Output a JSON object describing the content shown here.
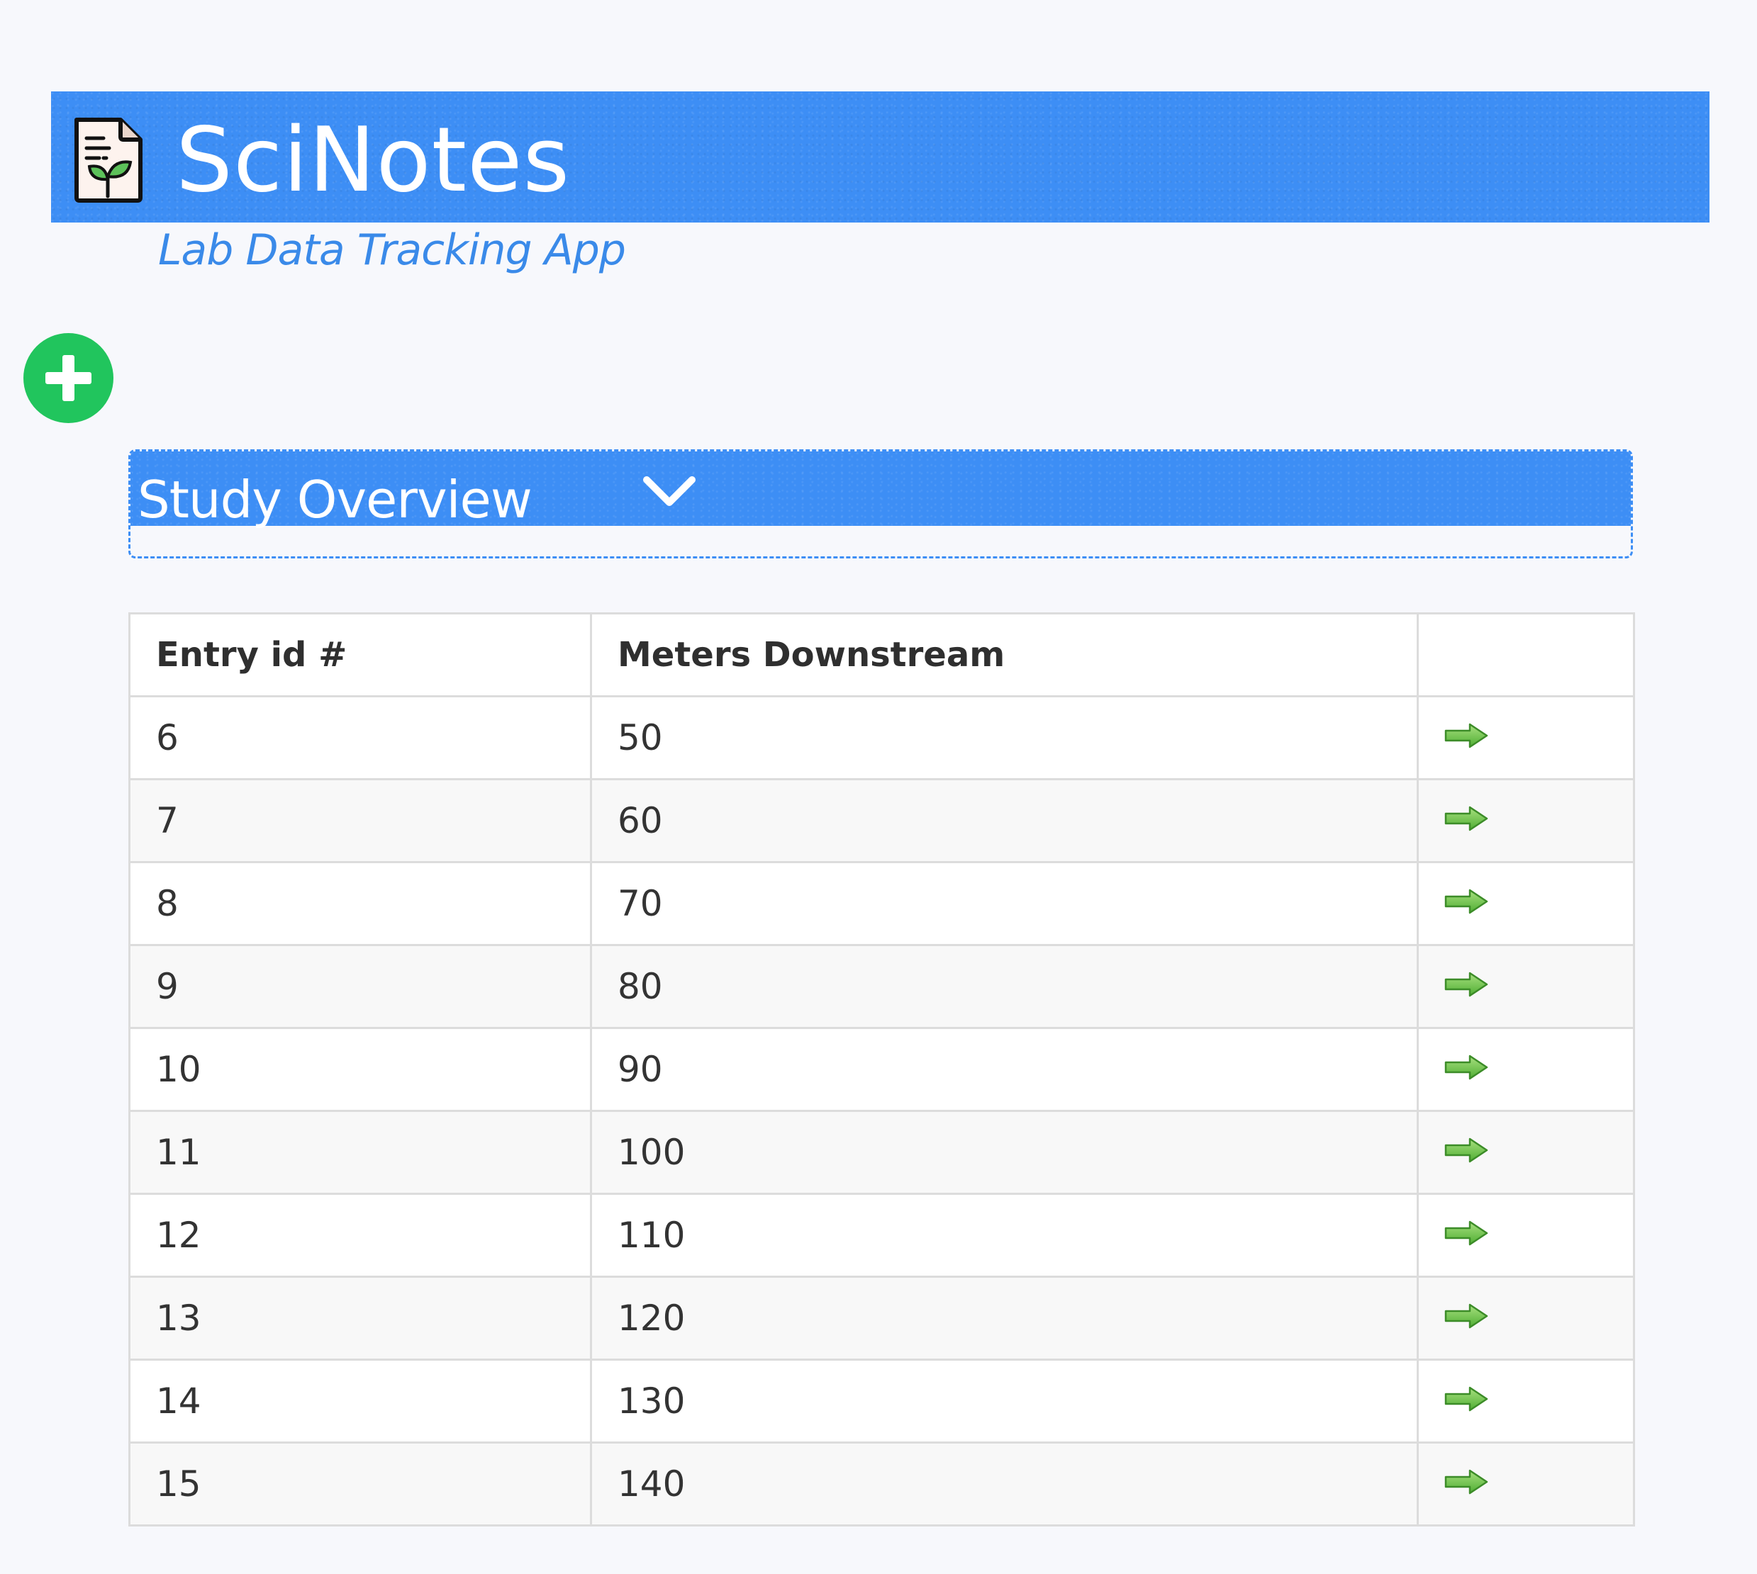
{
  "header": {
    "title": "SciNotes",
    "subtitle": "Lab Data Tracking App",
    "logo_icon": "notes-sprout-icon",
    "background_color": "#3d8ef5"
  },
  "actions": {
    "add_icon": "plus-circle-icon",
    "add_color": "#21c55d"
  },
  "section": {
    "title": "Study Overview",
    "toggle_icon": "chevron-down-icon"
  },
  "table": {
    "columns": [
      "Entry id #",
      "Meters Downstream",
      ""
    ],
    "rows": [
      {
        "id": "6",
        "meters": "50",
        "action_icon": "arrow-right-icon"
      },
      {
        "id": "7",
        "meters": "60",
        "action_icon": "arrow-right-icon"
      },
      {
        "id": "8",
        "meters": "70",
        "action_icon": "arrow-right-icon"
      },
      {
        "id": "9",
        "meters": "80",
        "action_icon": "arrow-right-icon"
      },
      {
        "id": "10",
        "meters": "90",
        "action_icon": "arrow-right-icon"
      },
      {
        "id": "11",
        "meters": "100",
        "action_icon": "arrow-right-icon"
      },
      {
        "id": "12",
        "meters": "110",
        "action_icon": "arrow-right-icon"
      },
      {
        "id": "13",
        "meters": "120",
        "action_icon": "arrow-right-icon"
      },
      {
        "id": "14",
        "meters": "130",
        "action_icon": "arrow-right-icon"
      },
      {
        "id": "15",
        "meters": "140",
        "action_icon": "arrow-right-icon"
      }
    ],
    "arrow_color": "#5cbf3a"
  }
}
